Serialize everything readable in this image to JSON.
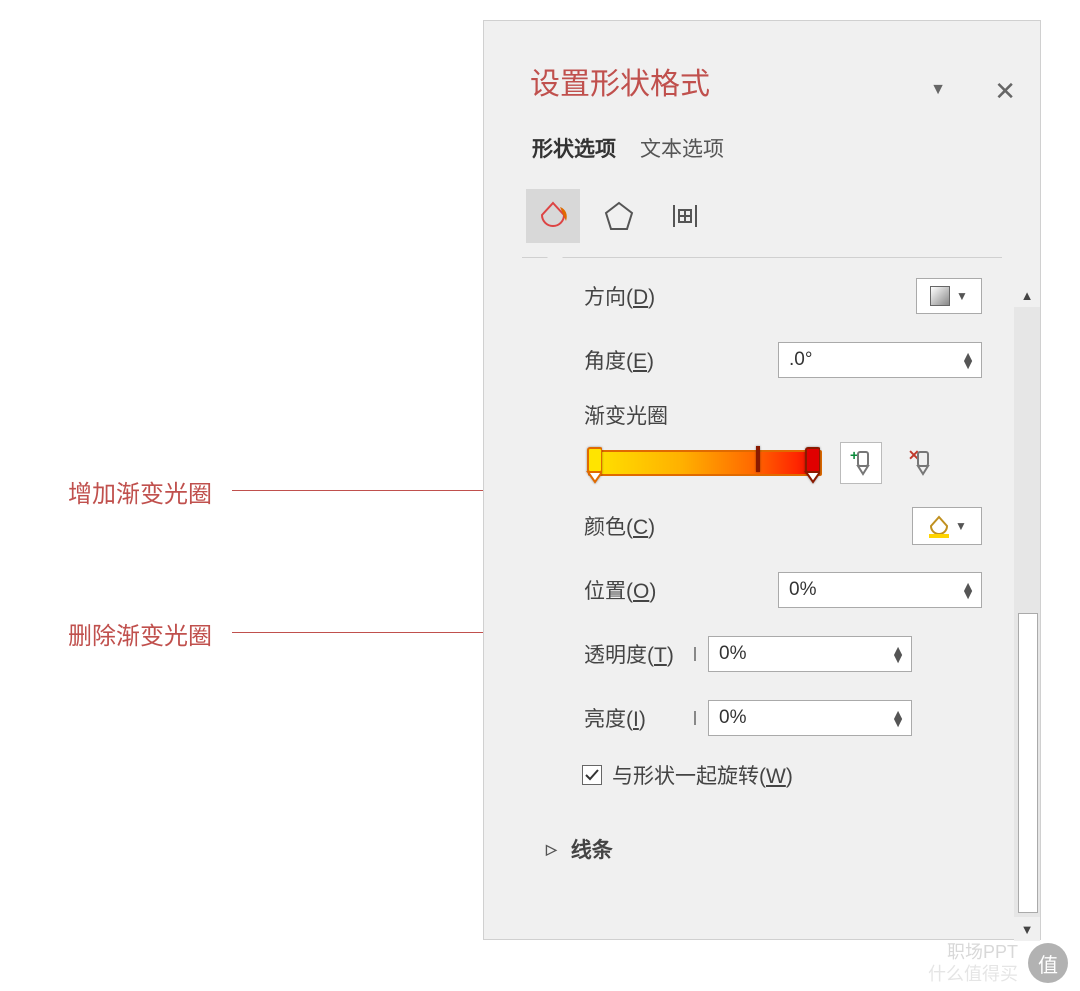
{
  "panel": {
    "title": "设置形状格式",
    "tabs": {
      "shape": "形状选项",
      "text": "文本选项"
    },
    "direction_label_pre": "方向(",
    "direction_key": "D",
    "label_close": ")",
    "angle_label_pre": "角度(",
    "angle_key": "E",
    "angle_value": ".0°",
    "gradstops_label": "渐变光圈",
    "color_label_pre": "颜色(",
    "color_key": "C",
    "position_label_pre": "位置(",
    "position_key": "O",
    "position_value": "0%",
    "trans_label_pre": "透明度(",
    "trans_key": "T",
    "trans_value": "0%",
    "bright_label_pre": "亮度(",
    "bright_key": "I",
    "bright_value": "0%",
    "rotate_label_pre": "与形状一起旋转(",
    "rotate_key": "W",
    "line_section": "线条"
  },
  "annot": {
    "add": "增加渐变光圈",
    "del": "删除渐变光圈"
  },
  "watermark": {
    "a": "职场PPT",
    "b": "什么值得买"
  }
}
